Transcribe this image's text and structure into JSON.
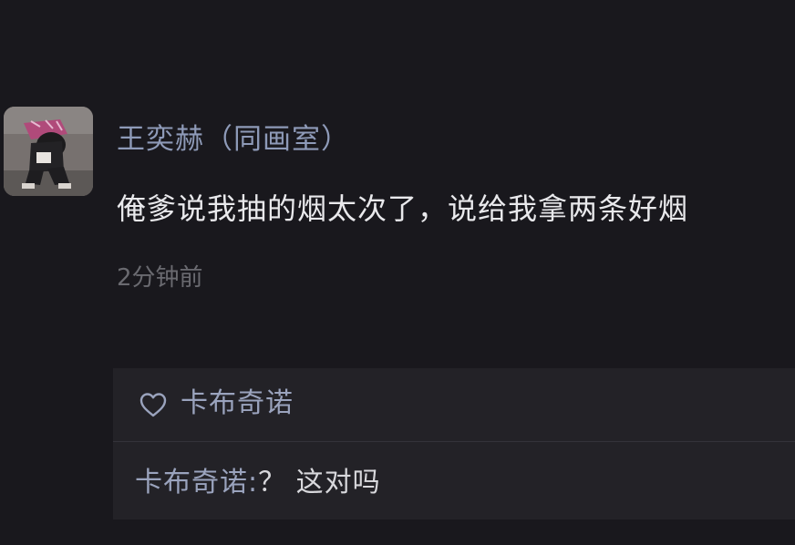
{
  "post": {
    "author": "王奕赫（同画室）",
    "content": "俺爹说我抽的烟太次了，说给我拿两条好烟",
    "time": "2分钟前"
  },
  "likes": {
    "icon": "heart-outline-icon",
    "users": "卡布奇诺"
  },
  "replies": [
    {
      "author": "卡布奇诺",
      "separator": ":",
      "text": "？ 这对吗"
    }
  ],
  "colors": {
    "background": "#19181d",
    "reply_box": "#232227",
    "name": "#8e9ab8",
    "text": "#e9e9ec",
    "time": "#6a6a70"
  }
}
